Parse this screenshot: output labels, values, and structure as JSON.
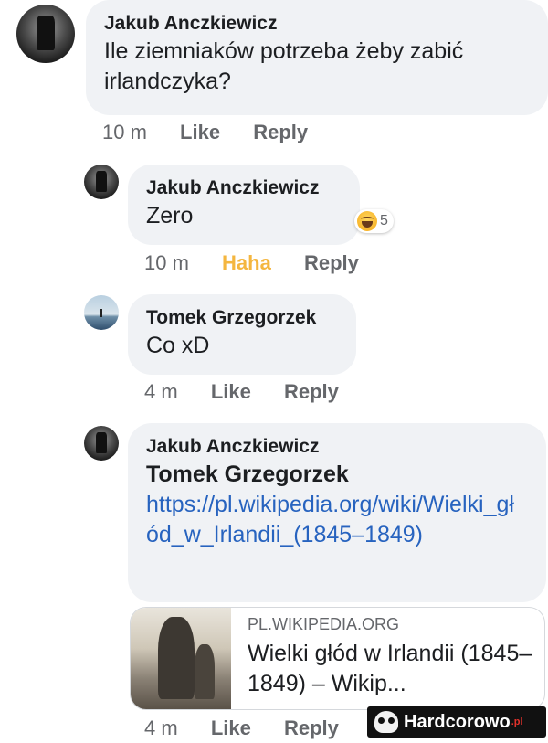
{
  "comments": [
    {
      "author": "Jakub Anczkiewicz",
      "text": "Ile ziemniaków potrzeba żeby zabić irlandczyka?",
      "time": "10 m",
      "like": "Like",
      "reply": "Reply"
    },
    {
      "author": "Jakub Anczkiewicz",
      "text": "Zero",
      "time": "10 m",
      "reaction_label": "Haha",
      "reaction_count": "5",
      "reply": "Reply"
    },
    {
      "author": "Tomek Grzegorzek",
      "text": "Co xD",
      "time": "4 m",
      "like": "Like",
      "reply": "Reply"
    },
    {
      "author": "Jakub Anczkiewicz",
      "mention": "Tomek Grzegorzek",
      "link": "https://pl.wikipedia.org/wiki/Wielki_głód_w_Irlandii_(1845–1849)",
      "time": "4 m",
      "like": "Like",
      "reply": "Reply",
      "preview": {
        "domain": "PL.WIKIPEDIA.ORG",
        "title": "Wielki głód w Irlandii (1845–1849) – Wikip..."
      }
    }
  ],
  "watermark": {
    "brand": "Hardcorowo",
    "tld": ".pl"
  },
  "colors": {
    "link": "#2763bf",
    "haha": "#f4b63f",
    "bubble": "#f0f2f5",
    "meta": "#65676b"
  }
}
